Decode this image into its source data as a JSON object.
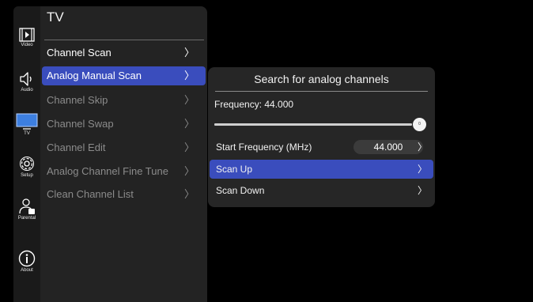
{
  "rail": {
    "items": [
      {
        "label": "Video",
        "icon": "video-icon"
      },
      {
        "label": "Audio",
        "icon": "speaker-icon"
      },
      {
        "label": "TV",
        "icon": "tv-icon"
      },
      {
        "label": "Setup",
        "icon": "gear-icon"
      },
      {
        "label": "Parental",
        "icon": "parental-lock-icon"
      },
      {
        "label": "About",
        "icon": "info-icon"
      }
    ],
    "active_color": "#3d7fe0"
  },
  "menu": {
    "title": "TV",
    "chevron": "〉",
    "items": [
      {
        "label": "Channel Scan",
        "state": "enabled"
      },
      {
        "label": "Analog Manual Scan",
        "state": "selected"
      },
      {
        "label": "Channel Skip",
        "state": "disabled"
      },
      {
        "label": "Channel Swap",
        "state": "disabled"
      },
      {
        "label": "Channel Edit",
        "state": "disabled"
      },
      {
        "label": "Analog Channel Fine Tune",
        "state": "disabled"
      },
      {
        "label": "Clean Channel List",
        "state": "disabled"
      }
    ]
  },
  "panel": {
    "title": "Search for analog channels",
    "frequency_label": "Frequency: 44.000",
    "slider_knob_text": "0",
    "slider_position": 1.0,
    "chevron": "〉",
    "rows": [
      {
        "label": "Start Frequency (MHz)",
        "value": "44.000"
      },
      {
        "label": "Scan Up",
        "state": "selected"
      },
      {
        "label": "Scan Down"
      }
    ]
  },
  "colors": {
    "selection": "#3a4dbd",
    "menu_bg": "#232323",
    "panel_bg": "#262626",
    "disabled_text": "#8b8b8b"
  }
}
